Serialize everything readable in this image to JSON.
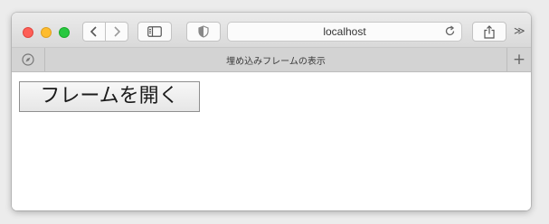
{
  "toolbar": {
    "address": "localhost"
  },
  "tab": {
    "title": "埋め込みフレームの表示"
  },
  "page": {
    "open_frame_button": "フレームを開く"
  },
  "icons": {
    "back": "chevron-left-icon",
    "forward": "chevron-right-icon",
    "sidebar": "sidebar-icon",
    "privacy": "shield-icon",
    "reload": "reload-icon",
    "share": "share-icon",
    "overflow": "double-chevron-icon",
    "compass": "compass-icon",
    "new_tab": "plus-icon"
  },
  "colors": {
    "close": "#fe5f57",
    "minimize": "#febc2e",
    "maximize": "#28c840"
  }
}
